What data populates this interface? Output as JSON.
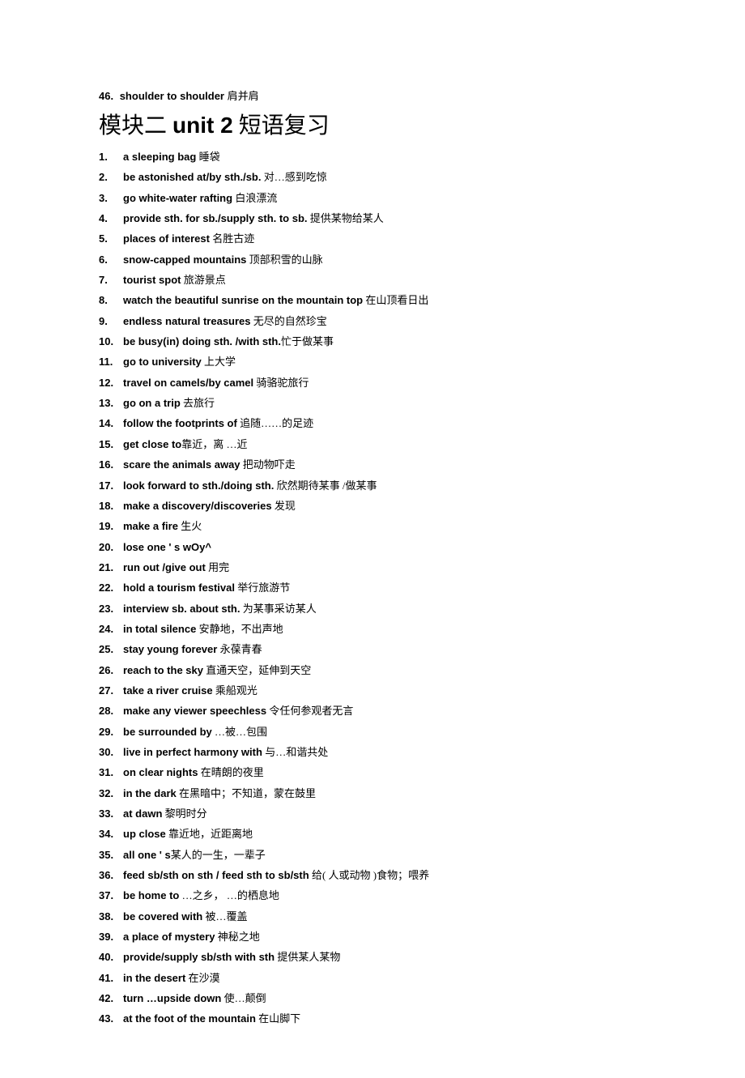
{
  "intro": {
    "num": "46.",
    "en": "shoulder to shoulder",
    "zh": " 肩并肩"
  },
  "title": {
    "pre": "模块二 ",
    "bold": "unit 2",
    "post": " 短语复习"
  },
  "items": [
    {
      "num": "1.",
      "en": "a sleeping bag",
      "zh": " 睡袋"
    },
    {
      "num": "2.",
      "en": "be astonished at/by sth./sb.",
      "zh": " 对…感到吃惊"
    },
    {
      "num": "3.",
      "en": "go white-water rafting",
      "zh": " 白浪漂流"
    },
    {
      "num": "4.",
      "en": "provide sth. for sb./supply sth. to sb.",
      "zh": " 提供某物给某人"
    },
    {
      "num": "5.",
      "en": "places of interest",
      "zh": " 名胜古迹"
    },
    {
      "num": "6.",
      "en": "snow-capped mountains",
      "zh": " 顶部积雪的山脉"
    },
    {
      "num": "7.",
      "en": "tourist spot",
      "zh": " 旅游景点"
    },
    {
      "num": "8.",
      "en": "watch the beautiful sunrise on the mountain top",
      "zh": " 在山顶看日出"
    },
    {
      "num": "9.",
      "en": "endless natural treasures",
      "zh": " 无尽的自然珍宝"
    },
    {
      "num": "10.",
      "en": "be busy(in) doing sth. /with sth.",
      "zh": "忙于做某事"
    },
    {
      "num": "11.",
      "en": "go to university",
      "zh": " 上大学"
    },
    {
      "num": "12.",
      "en": "travel on camels/by camel",
      "zh": " 骑骆驼旅行"
    },
    {
      "num": "13.",
      "en": "go on a trip",
      "zh": " 去旅行"
    },
    {
      "num": "14.",
      "en": "follow the footprints of",
      "zh": " 追随……的足迹"
    },
    {
      "num": "15.",
      "en": "get close to",
      "zh": "靠近，离 …近"
    },
    {
      "num": "16.",
      "en": "scare the animals away",
      "zh": " 把动物吓走"
    },
    {
      "num": "17.",
      "en": "look forward to sth./doing sth.",
      "zh": " 欣然期待某事 /做某事"
    },
    {
      "num": "18.",
      "en": "make a discovery/discoveries",
      "zh": " 发现"
    },
    {
      "num": "19.",
      "en": "make a fire",
      "zh": " 生火"
    },
    {
      "num": "20.",
      "en": "lose one ' s wOy^",
      "zh": ""
    },
    {
      "num": "21.",
      "en": "run out /give out",
      "zh": " 用完"
    },
    {
      "num": "22.",
      "en": "hold a tourism festival",
      "zh": " 举行旅游节"
    },
    {
      "num": "23.",
      "en": "interview sb. about sth.",
      "zh": " 为某事采访某人"
    },
    {
      "num": "24.",
      "en": "in total silence",
      "zh": " 安静地，不出声地"
    },
    {
      "num": "25.",
      "en": "stay young forever",
      "zh": " 永葆青春"
    },
    {
      "num": "26.",
      "en": "reach to the sky",
      "zh": " 直通天空，延伸到天空"
    },
    {
      "num": "27.",
      "en": "take a river cruise",
      "zh": " 乘船观光"
    },
    {
      "num": "28.",
      "en": "make any viewer speechless",
      "zh": " 令任何参观者无言"
    },
    {
      "num": "29.",
      "en": "be surrounded by",
      "zh": " …被…包围"
    },
    {
      "num": "30.",
      "en": "live in perfect harmony with",
      "zh": " 与…和谐共处"
    },
    {
      "num": "31.",
      "en": "on clear nights",
      "zh": " 在晴朗的夜里"
    },
    {
      "num": "32.",
      "en": "in the dark",
      "zh": " 在黑暗中；不知道，蒙在鼓里"
    },
    {
      "num": "33.",
      "en": "at dawn",
      "zh": " 黎明时分"
    },
    {
      "num": "34.",
      "en": "up close",
      "zh": " 靠近地，近距离地"
    },
    {
      "num": "35.",
      "en": "all one ' s",
      "zh": "某人的一生，一辈子"
    },
    {
      "num": "36.",
      "en": "feed sb/sth on sth / feed sth to sb/sth",
      "zh": " 给( 人或动物 )食物；喂养"
    },
    {
      "num": "37.",
      "en": "be home to",
      "zh": " …之乡， …的栖息地"
    },
    {
      "num": "38.",
      "en": "be covered with",
      "zh": " 被…覆盖"
    },
    {
      "num": "39.",
      "en": "a place of mystery",
      "zh": " 神秘之地"
    },
    {
      "num": "40.",
      "en": "provide/supply sb/sth with sth",
      "zh": " 提供某人某物"
    },
    {
      "num": "41.",
      "en": "in the desert",
      "zh": " 在沙漠"
    },
    {
      "num": "42.",
      "en": "turn …upside down",
      "zh": " 使…颠倒"
    },
    {
      "num": "43.",
      "en": "at the foot of the mountain",
      "zh": " 在山脚下"
    }
  ]
}
